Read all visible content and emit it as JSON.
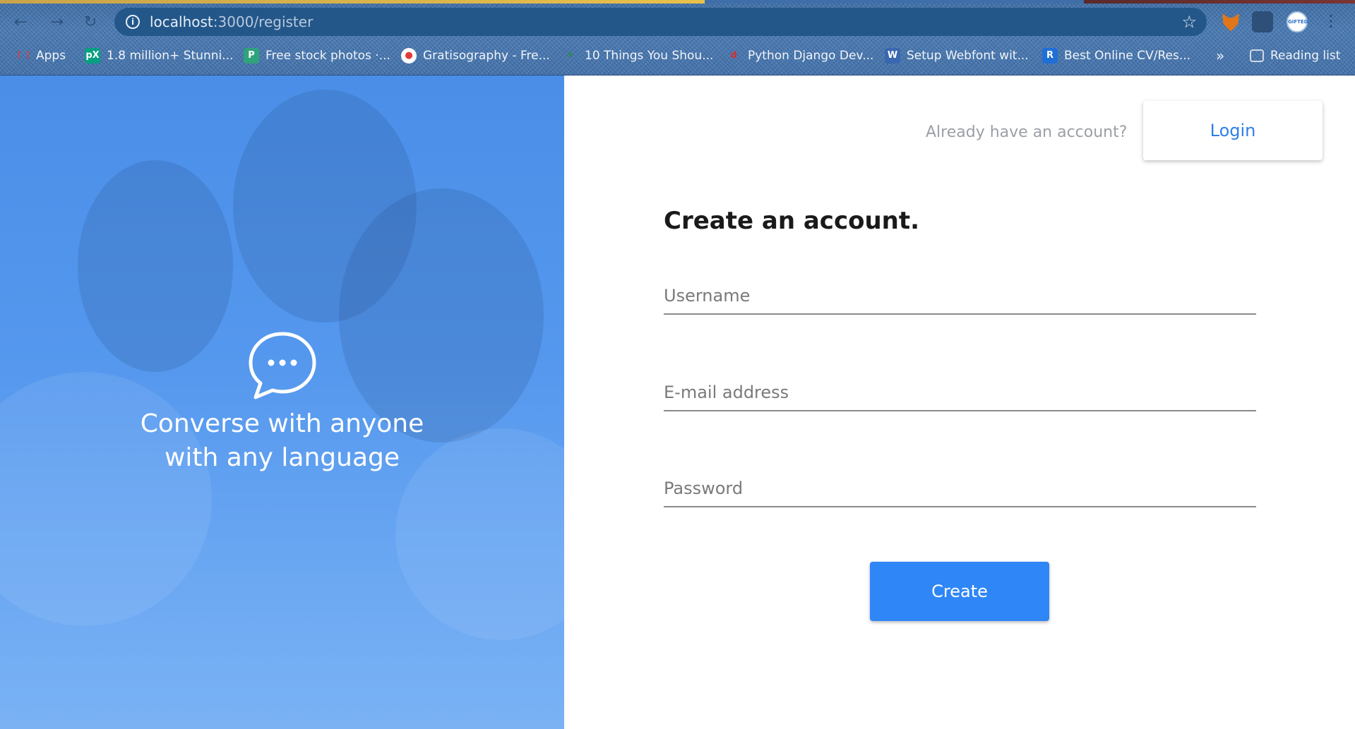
{
  "browser": {
    "url_host": "localhost",
    "url_path": ":3000/register",
    "nav": {
      "back": "←",
      "forward": "→",
      "reload": "↻"
    },
    "extensions": {
      "avatar_text": "GIFTED",
      "menu_glyph": "⋮"
    },
    "bookmarks": [
      {
        "label": "Apps",
        "icon": "apps-grid-icon",
        "glyph": "⋮⋮",
        "color": "#e53935"
      },
      {
        "label": "1.8 million+ Stunni...",
        "icon": "pexels-icon",
        "glyph": "pX",
        "color": "#05a081"
      },
      {
        "label": "Free stock photos ·...",
        "icon": "stock-photos-icon",
        "glyph": "P",
        "color": "#2fa37a"
      },
      {
        "label": "Gratisography - Fre...",
        "icon": "gratisography-icon",
        "glyph": "●",
        "color": "#e53935"
      },
      {
        "label": "10 Things You Shou...",
        "icon": "article-icon",
        "glyph": "⏵",
        "color": "#2e8b57"
      },
      {
        "label": "Python Django Dev...",
        "icon": "django-icon",
        "glyph": "d",
        "color": "#d32f2f"
      },
      {
        "label": "Setup Webfont wit...",
        "icon": "webfont-icon",
        "glyph": "W",
        "color": "#3a67b0"
      },
      {
        "label": "Best Online CV/Res...",
        "icon": "resume-icon",
        "glyph": "R",
        "color": "#1f6fd6"
      }
    ],
    "overflow_glyph": "»",
    "reading_list": "Reading list"
  },
  "hero": {
    "tagline_line1": "Converse with anyone",
    "tagline_line2": "with any language"
  },
  "auth": {
    "prompt": "Already have an account?",
    "login_label": "Login",
    "title": "Create an account.",
    "username_placeholder": "Username",
    "email_placeholder": "E-mail address",
    "password_placeholder": "Password",
    "submit_label": "Create"
  },
  "colors": {
    "accent": "#2f86f6",
    "hero_blue": "#4a8ee8",
    "login_text": "#2f7fe8"
  }
}
